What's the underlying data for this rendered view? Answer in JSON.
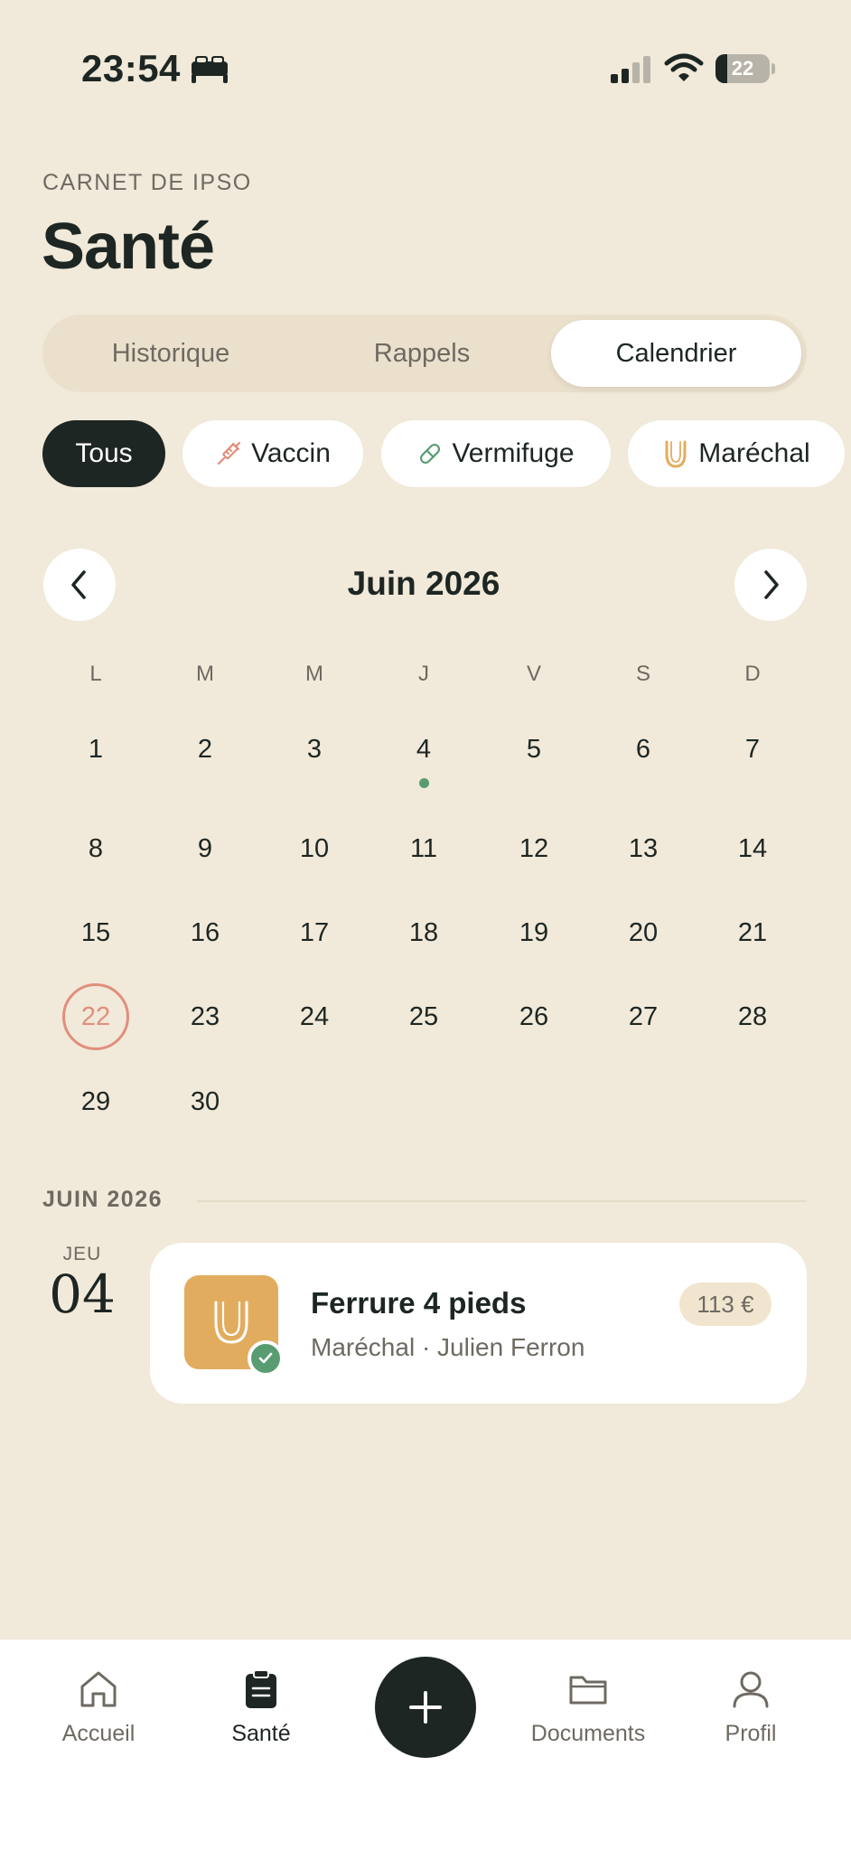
{
  "status_bar": {
    "time": "23:54",
    "battery": "22",
    "battery_level": 0.22
  },
  "header": {
    "eyebrow": "CARNET DE IPSO",
    "title": "Santé"
  },
  "tabs": [
    {
      "label": "Historique",
      "active": false
    },
    {
      "label": "Rappels",
      "active": false
    },
    {
      "label": "Calendrier",
      "active": true
    }
  ],
  "filters": [
    {
      "label": "Tous",
      "active": true,
      "icon": ""
    },
    {
      "label": "Vaccin",
      "active": false,
      "icon": "syringe-icon",
      "color": "#E08F7D"
    },
    {
      "label": "Vermifuge",
      "active": false,
      "icon": "pill-icon",
      "color": "#5A9C72"
    },
    {
      "label": "Maréchal",
      "active": false,
      "icon": "horseshoe-icon",
      "color": "#E2AC5E"
    }
  ],
  "calendar": {
    "month_label": "Juin 2026",
    "weekdays": [
      "L",
      "M",
      "M",
      "J",
      "V",
      "S",
      "D"
    ],
    "days": [
      "1",
      "2",
      "3",
      "4",
      "5",
      "6",
      "7",
      "8",
      "9",
      "10",
      "11",
      "12",
      "13",
      "14",
      "15",
      "16",
      "17",
      "18",
      "19",
      "20",
      "21",
      "22",
      "23",
      "24",
      "25",
      "26",
      "27",
      "28",
      "29",
      "30"
    ],
    "today": "22",
    "event_days": [
      "4"
    ]
  },
  "agenda": {
    "section_label": "JUIN 2026",
    "events": [
      {
        "weekday": "JEU",
        "day": "04",
        "title": "Ferrure 4 pieds",
        "subtitle": "Maréchal · Julien Ferron",
        "price": "113 €",
        "category_icon": "horseshoe-icon",
        "done": true
      }
    ]
  },
  "tab_bar": [
    {
      "label": "Accueil",
      "icon": "home-icon",
      "active": false
    },
    {
      "label": "Santé",
      "icon": "clipboard-icon",
      "active": true
    },
    {
      "label": "Documents",
      "icon": "folder-icon",
      "active": false
    },
    {
      "label": "Profil",
      "icon": "user-icon",
      "active": false
    }
  ],
  "colors": {
    "background": "#F1E9D9",
    "ink": "#1D2623",
    "today_accent": "#E08F7D",
    "event_green": "#5A9C72",
    "marechal_tile": "#E2AC5E"
  }
}
